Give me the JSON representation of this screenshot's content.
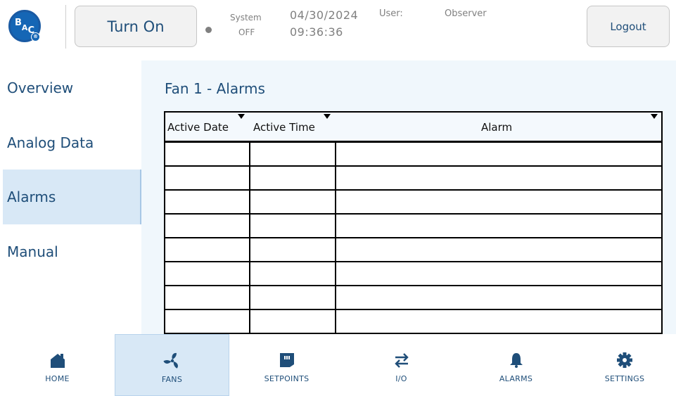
{
  "header": {
    "logo_text": "BAC",
    "turn_on_label": "Turn On",
    "system_label": "System",
    "system_state": "OFF",
    "date": "04/30/2024",
    "time": "09:36:36",
    "user_label": "User:",
    "user_name": "Observer",
    "logout_label": "Logout"
  },
  "sidebar": {
    "items": [
      {
        "label": "Overview",
        "active": false
      },
      {
        "label": "Analog Data",
        "active": false
      },
      {
        "label": "Alarms",
        "active": true
      },
      {
        "label": "Manual",
        "active": false
      }
    ]
  },
  "main": {
    "title": "Fan 1 - Alarms",
    "table": {
      "columns": [
        "Active Date",
        "Active Time",
        "Alarm"
      ],
      "rows": [
        [
          "",
          "",
          ""
        ],
        [
          "",
          "",
          ""
        ],
        [
          "",
          "",
          ""
        ],
        [
          "",
          "",
          ""
        ],
        [
          "",
          "",
          ""
        ],
        [
          "",
          "",
          ""
        ],
        [
          "",
          "",
          ""
        ],
        [
          "",
          "",
          ""
        ]
      ]
    }
  },
  "bottom_nav": {
    "items": [
      {
        "label": "HOME",
        "icon": "home-icon",
        "active": false
      },
      {
        "label": "FANS",
        "icon": "fan-icon",
        "active": true
      },
      {
        "label": "SETPOINTS",
        "icon": "setpoints-icon",
        "active": false
      },
      {
        "label": "I/O",
        "icon": "io-arrows-icon",
        "active": false
      },
      {
        "label": "ALARMS",
        "icon": "bell-icon",
        "active": false
      },
      {
        "label": "SETTINGS",
        "icon": "gear-icon",
        "active": false
      }
    ]
  },
  "colors": {
    "brand_blue": "#1566b5",
    "text_blue": "#1f4e79",
    "active_bg": "#d8e8f6",
    "panel_bg": "#f0f7fc"
  }
}
